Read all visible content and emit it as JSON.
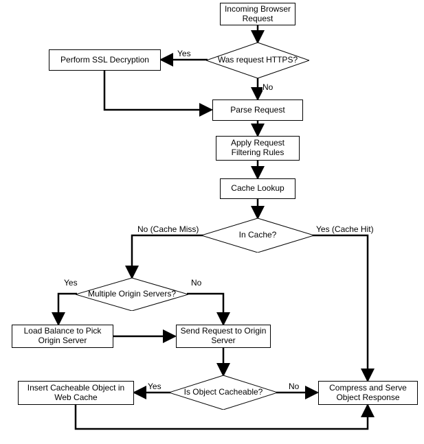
{
  "nodes": {
    "start": "Incoming Browser Request",
    "https_q": "Was request HTTPS?",
    "ssl": "Perform SSL Decryption",
    "parse": "Parse Request",
    "filter": "Apply Request Filtering Rules",
    "cache_lookup": "Cache Lookup",
    "in_cache_q": "In Cache?",
    "multi_origin_q": "Multiple Origin Servers?",
    "load_balance": "Load Balance to Pick Origin Server",
    "send_origin": "Send Request to Origin Server",
    "cacheable_q": "Is Object Cacheable?",
    "insert_cache": "Insert Cacheable Object in Web Cache",
    "compress_serve": "Compress and Serve Object Response"
  },
  "labels": {
    "yes": "Yes",
    "no": "No",
    "cache_miss": "No (Cache Miss)",
    "cache_hit": "Yes (Cache Hit)"
  }
}
